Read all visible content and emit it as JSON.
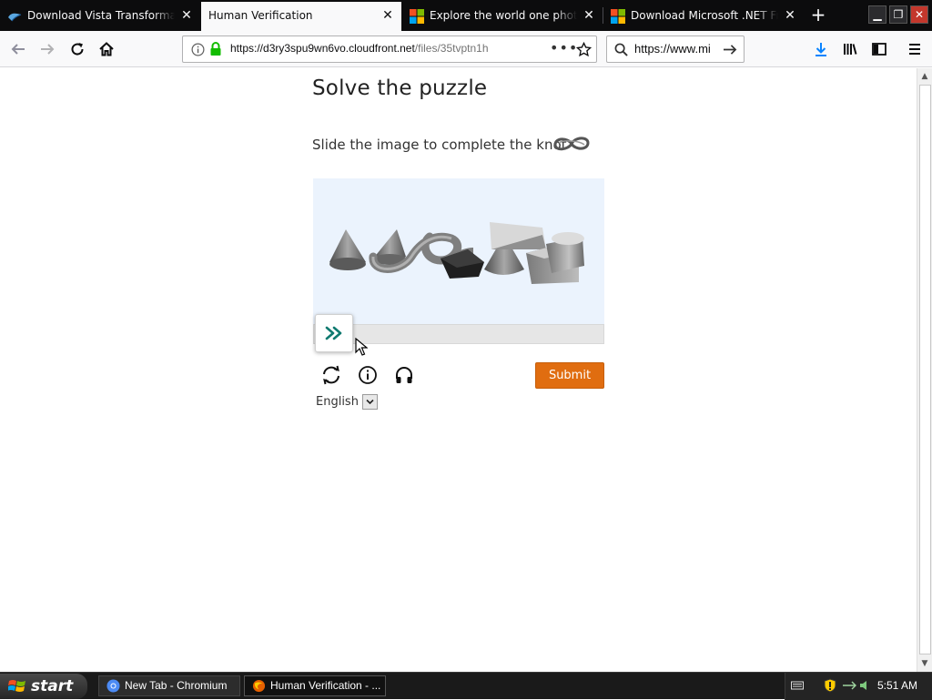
{
  "browser": {
    "tabs": [
      {
        "title": "Download Vista Transformation Pack",
        "favicon": "vista-logo-icon",
        "active": false
      },
      {
        "title": "Human Verification",
        "favicon": "",
        "active": true
      },
      {
        "title": "Explore the world one photo at a time",
        "favicon": "microsoft-logo-icon",
        "active": false
      },
      {
        "title": "Download Microsoft .NET Framework",
        "favicon": "microsoft-logo-icon",
        "active": false
      }
    ],
    "new_tab_label": "+",
    "url": {
      "host": "https://d3ry3spu9wn6vo.cloudfront.net",
      "path": "/files/35tvptn1h"
    },
    "search_value": "https://www.mi"
  },
  "puzzle": {
    "heading": "Solve the puzzle",
    "instruction": "Slide the image to complete the knot",
    "submit_label": "Submit",
    "language": "English",
    "image_background": "#ebf3fd",
    "submit_color": "#e06d10",
    "slider_accent": "#0f7a70"
  },
  "taskbar": {
    "start_label": "start",
    "tasks": [
      {
        "label": "New Tab - Chromium",
        "icon": "chromium-icon",
        "active": false
      },
      {
        "label": "Human Verification - ...",
        "icon": "firefox-icon",
        "active": true
      }
    ],
    "clock": "5:51 AM"
  }
}
